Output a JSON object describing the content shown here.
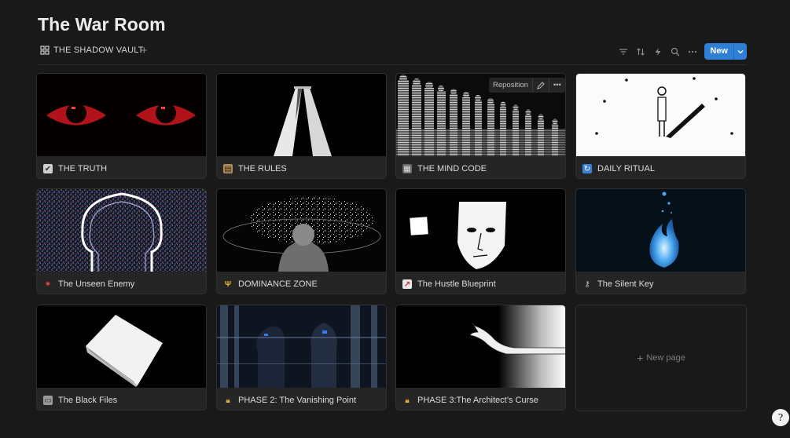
{
  "page": {
    "title": "The War Room"
  },
  "view": {
    "name": "THE SHADOW VAULT",
    "add": "+"
  },
  "toolbar": {
    "new_label": "New",
    "icons": [
      "filter-icon",
      "sort-icon",
      "automation-icon",
      "search-icon",
      "more-icon"
    ]
  },
  "cover_controls": {
    "reposition": "Reposition",
    "edit_icon": "pencil-icon",
    "more": "•••"
  },
  "cards": [
    {
      "title": "THE TRUTH",
      "icon": "check-box-icon",
      "glyph": "✔"
    },
    {
      "title": "THE RULES",
      "icon": "scroll-icon",
      "glyph": "▤"
    },
    {
      "title": "THE MIND CODE",
      "icon": "notebook-icon",
      "glyph": "▦"
    },
    {
      "title": "DAILY RITUAL",
      "icon": "repeat-icon",
      "glyph": "↻"
    },
    {
      "title": "The Unseen Enemy",
      "icon": "anger-symbol-icon",
      "glyph": "✷"
    },
    {
      "title": "DOMINANCE ZONE",
      "icon": "trident-icon",
      "glyph": "Ψ"
    },
    {
      "title": "The Hustle Blueprint",
      "icon": "chart-icon",
      "glyph": "↗"
    },
    {
      "title": "The Silent Key",
      "icon": "key-icon",
      "glyph": "⚷"
    },
    {
      "title": "The Black Files",
      "icon": "folder-icon",
      "glyph": "▭"
    },
    {
      "title": "PHASE 2: The Vanishing Point",
      "icon": "lock-icon",
      "glyph": "🔒︎"
    },
    {
      "title": "PHASE 3:The Architect’s Curse",
      "icon": "lock-icon",
      "glyph": "🔒︎"
    }
  ],
  "new_page": {
    "plus": "+",
    "label": "New page"
  },
  "helper": {
    "glyph": "?"
  }
}
